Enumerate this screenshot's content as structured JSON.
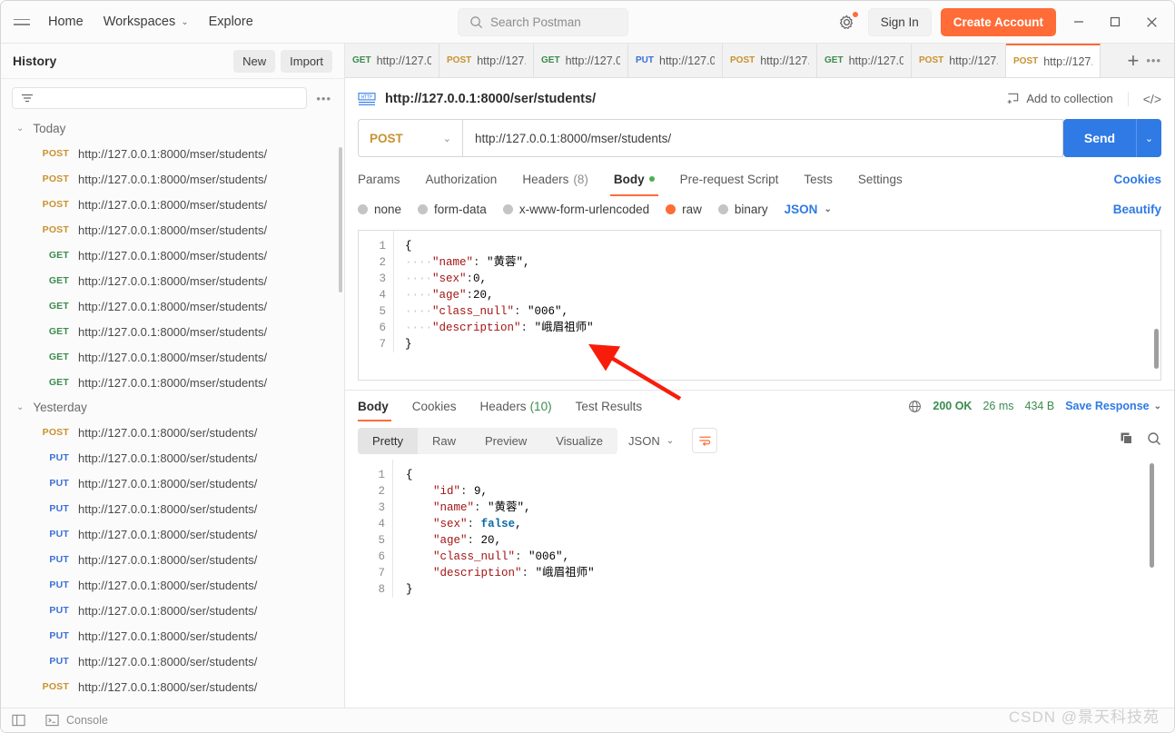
{
  "app": {
    "search_placeholder": "Search Postman",
    "watermark": "CSDN @景天科技苑"
  },
  "topnav": {
    "menu_icon": "hamburger-icon",
    "items": [
      {
        "label": "Home",
        "has_chevron": false
      },
      {
        "label": "Workspaces",
        "has_chevron": true
      },
      {
        "label": "Explore",
        "has_chevron": false
      }
    ],
    "chevron": "⌄",
    "sign_in": "Sign In",
    "create_account": "Create Account",
    "settings_icon": "gear-icon",
    "window_minimize": "minimize-icon",
    "window_maximize": "maximize-icon",
    "window_close": "close-icon"
  },
  "sidebar": {
    "title": "History",
    "new_button": "New",
    "import_button": "Import",
    "filter_placeholder": "",
    "more_options": "•••",
    "groups": [
      {
        "label": "Today",
        "chevron": "⌄",
        "items": [
          {
            "method": "POST",
            "url": "http://127.0.0.1:8000/mser/students/"
          },
          {
            "method": "POST",
            "url": "http://127.0.0.1:8000/mser/students/"
          },
          {
            "method": "POST",
            "url": "http://127.0.0.1:8000/mser/students/"
          },
          {
            "method": "POST",
            "url": "http://127.0.0.1:8000/mser/students/"
          },
          {
            "method": "GET",
            "url": "http://127.0.0.1:8000/mser/students/"
          },
          {
            "method": "GET",
            "url": "http://127.0.0.1:8000/mser/students/"
          },
          {
            "method": "GET",
            "url": "http://127.0.0.1:8000/mser/students/"
          },
          {
            "method": "GET",
            "url": "http://127.0.0.1:8000/mser/students/"
          },
          {
            "method": "GET",
            "url": "http://127.0.0.1:8000/mser/students/"
          },
          {
            "method": "GET",
            "url": "http://127.0.0.1:8000/mser/students/"
          }
        ]
      },
      {
        "label": "Yesterday",
        "chevron": "⌄",
        "items": [
          {
            "method": "POST",
            "url": "http://127.0.0.1:8000/ser/students/"
          },
          {
            "method": "PUT",
            "url": "http://127.0.0.1:8000/ser/students/"
          },
          {
            "method": "PUT",
            "url": "http://127.0.0.1:8000/ser/students/"
          },
          {
            "method": "PUT",
            "url": "http://127.0.0.1:8000/ser/students/"
          },
          {
            "method": "PUT",
            "url": "http://127.0.0.1:8000/ser/students/"
          },
          {
            "method": "PUT",
            "url": "http://127.0.0.1:8000/ser/students/"
          },
          {
            "method": "PUT",
            "url": "http://127.0.0.1:8000/ser/students/"
          },
          {
            "method": "PUT",
            "url": "http://127.0.0.1:8000/ser/students/"
          },
          {
            "method": "PUT",
            "url": "http://127.0.0.1:8000/ser/students/"
          },
          {
            "method": "PUT",
            "url": "http://127.0.0.1:8000/ser/students/"
          },
          {
            "method": "POST",
            "url": "http://127.0.0.1:8000/ser/students/"
          }
        ]
      }
    ]
  },
  "request_tabs": {
    "tabs": [
      {
        "method": "GET",
        "url": "http://127.0.",
        "active": false
      },
      {
        "method": "POST",
        "url": "http://127.0",
        "active": false
      },
      {
        "method": "GET",
        "url": "http://127.0.",
        "active": false
      },
      {
        "method": "PUT",
        "url": "http://127.0.",
        "active": false
      },
      {
        "method": "POST",
        "url": "http://127.0",
        "active": false
      },
      {
        "method": "GET",
        "url": "http://127.0.",
        "active": false
      },
      {
        "method": "POST",
        "url": "http://127.0",
        "active": false
      },
      {
        "method": "POST",
        "url": "http://127.0",
        "active": true
      }
    ],
    "new_tab": "+",
    "tab_options": "•••"
  },
  "request": {
    "breadcrumb_title": "http://127.0.0.1:8000/ser/students/",
    "protocol_icon": "http-icon",
    "add_to_collection": "Add to collection",
    "code_icon": "code-snippet-icon",
    "method": "POST",
    "method_chevron": "⌄",
    "url": "http://127.0.0.1:8000/mser/students/",
    "send_label": "Send",
    "send_chevron": "⌄",
    "tabs": [
      {
        "label": "Params",
        "active": false,
        "count": "",
        "dot": false
      },
      {
        "label": "Authorization",
        "active": false,
        "count": "",
        "dot": false
      },
      {
        "label": "Headers",
        "active": false,
        "count": "(8)",
        "dot": false
      },
      {
        "label": "Body",
        "active": true,
        "count": "",
        "dot": true
      },
      {
        "label": "Pre-request Script",
        "active": false,
        "count": "",
        "dot": false
      },
      {
        "label": "Tests",
        "active": false,
        "count": "",
        "dot": false
      },
      {
        "label": "Settings",
        "active": false,
        "count": "",
        "dot": false
      }
    ],
    "cookies_link": "Cookies",
    "body_types": [
      {
        "label": "none",
        "selected": false
      },
      {
        "label": "form-data",
        "selected": false
      },
      {
        "label": "x-www-form-urlencoded",
        "selected": false
      },
      {
        "label": "raw",
        "selected": true
      },
      {
        "label": "binary",
        "selected": false
      }
    ],
    "body_format": "JSON",
    "body_format_chevron": "⌄",
    "beautify": "Beautify",
    "body_lines": [
      {
        "n": "1",
        "text": "{"
      },
      {
        "n": "2",
        "text": "    \"name\": \"黄蓉\","
      },
      {
        "n": "3",
        "text": "    \"sex\":0,"
      },
      {
        "n": "4",
        "text": "    \"age\":20,"
      },
      {
        "n": "5",
        "text": "    \"class_null\": \"006\","
      },
      {
        "n": "6",
        "text": "    \"description\": \"峨眉祖师\""
      },
      {
        "n": "7",
        "text": "}"
      }
    ]
  },
  "response": {
    "tabs": [
      {
        "label": "Body",
        "active": true,
        "count": ""
      },
      {
        "label": "Cookies",
        "active": false,
        "count": ""
      },
      {
        "label": "Headers",
        "active": false,
        "count": "(10)"
      },
      {
        "label": "Test Results",
        "active": false,
        "count": ""
      }
    ],
    "globe_icon": "globe-icon",
    "status": "200 OK",
    "time": "26 ms",
    "size": "434 B",
    "save_response": "Save Response",
    "save_chevron": "⌄",
    "views": [
      {
        "label": "Pretty",
        "active": true
      },
      {
        "label": "Raw",
        "active": false
      },
      {
        "label": "Preview",
        "active": false
      },
      {
        "label": "Visualize",
        "active": false
      }
    ],
    "format": "JSON",
    "format_chevron": "⌄",
    "wrap_icon": "word-wrap-icon",
    "copy_icon": "copy-icon",
    "search_icon": "search-icon",
    "body_lines": [
      {
        "n": "1",
        "text": "{"
      },
      {
        "n": "2",
        "text": "    \"id\": 9,"
      },
      {
        "n": "3",
        "text": "    \"name\": \"黄蓉\","
      },
      {
        "n": "4",
        "text": "    \"sex\": false,"
      },
      {
        "n": "5",
        "text": "    \"age\": 20,"
      },
      {
        "n": "6",
        "text": "    \"class_null\": \"006\","
      },
      {
        "n": "7",
        "text": "    \"description\": \"峨眉祖师\""
      },
      {
        "n": "8",
        "text": "}"
      }
    ]
  },
  "statusbar": {
    "sidebar_toggle_icon": "panel-toggle-icon",
    "console_icon": "terminal-icon",
    "console_label": "Console"
  },
  "colors": {
    "accent": "#ff6c37",
    "send": "#2f7ae5",
    "get": "#3b8c4e",
    "post": "#c8922e",
    "put": "#3a6fd8",
    "success": "#3b8c4e"
  }
}
